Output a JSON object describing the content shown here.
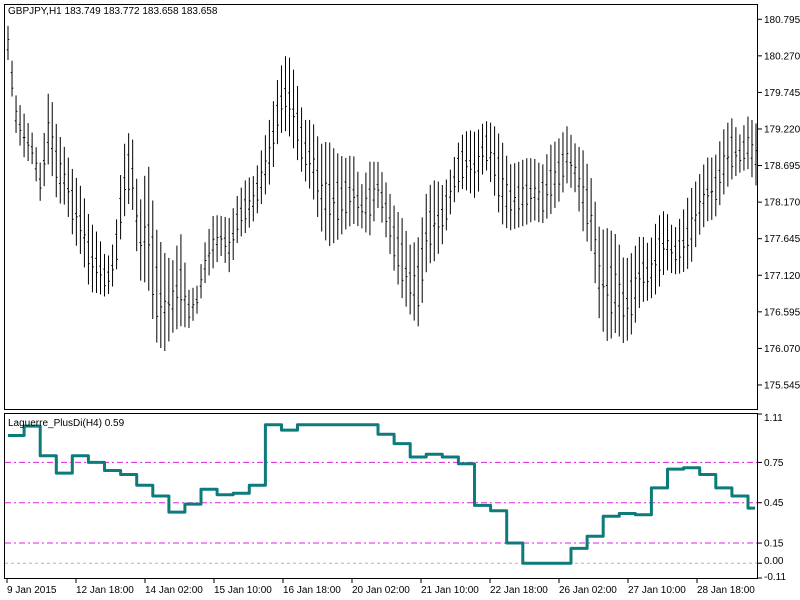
{
  "colors": {
    "background": "#ffffff",
    "frame": "#000000",
    "bars": "#000000",
    "indicator_line": "#0e7b7b",
    "level_line": "#e020e0",
    "zero_level": "#b0b0b0"
  },
  "chart_data": [
    {
      "type": "bar",
      "subtype": "ohlc",
      "title": "GBPJPY,H1  183.749 183.772 183.658 183.658",
      "symbol": "GBPJPY",
      "timeframe": "H1",
      "ohlc_shown": [
        183.749,
        183.772,
        183.658,
        183.658
      ],
      "ylim": [
        175.2,
        181.0
      ],
      "y_ticks": [
        180.795,
        180.27,
        179.745,
        179.22,
        178.695,
        178.17,
        177.645,
        177.12,
        176.595,
        176.07,
        175.545
      ],
      "y_tick_labels": [
        "180.795",
        "180.270",
        "179.745",
        "179.220",
        "178.695",
        "178.170",
        "177.645",
        "177.120",
        "176.595",
        "176.070",
        "175.545"
      ],
      "grid": false,
      "bar_count": 187,
      "bars_high": [
        180.7,
        179.68,
        179.43,
        179.15,
        178.7,
        179.85,
        179.21,
        178.92,
        178.59,
        178.36,
        177.9,
        177.7,
        177.33,
        177.65,
        178.95,
        179.26,
        178.11,
        178.8,
        177.81,
        177.45,
        177.31,
        177.74,
        176.91,
        176.97,
        177.61,
        177.99,
        177.97,
        177.94,
        178.3,
        178.51,
        178.55,
        178.99,
        179.44,
        180.06,
        180.33,
        179.98,
        179.35,
        179.35,
        179.0,
        179.05,
        178.88,
        178.8,
        178.86,
        178.41,
        178.75,
        178.75,
        178.45,
        178.11,
        177.93,
        177.53,
        177.68,
        178.37,
        178.5,
        178.4,
        178.69,
        179.11,
        179.21,
        179.17,
        179.34,
        179.3,
        179.09,
        178.71,
        178.74,
        178.8,
        178.8,
        178.69,
        178.99,
        179.08,
        179.26,
        179.01,
        178.91,
        178.49,
        177.76,
        177.8,
        177.7,
        177.32,
        177.46,
        177.72,
        177.55,
        177.95,
        178.07,
        177.76,
        178.0,
        178.34,
        178.53,
        178.81,
        178.81,
        179.2,
        179.39,
        179.13,
        179.4,
        179.3
      ],
      "bars_low": [
        180.21,
        179.14,
        178.8,
        178.71,
        178.14,
        178.78,
        178.16,
        178.13,
        177.62,
        177.38,
        176.88,
        176.86,
        176.8,
        177.02,
        177.9,
        178.26,
        177.05,
        177.0,
        176.17,
        176.01,
        176.29,
        176.39,
        176.36,
        176.57,
        177.02,
        177.23,
        177.41,
        177.14,
        177.64,
        177.74,
        177.92,
        178.19,
        178.48,
        179.15,
        179.2,
        178.85,
        178.51,
        178.3,
        177.79,
        177.53,
        177.61,
        177.77,
        177.86,
        177.8,
        177.68,
        178.09,
        177.66,
        177.17,
        176.77,
        176.54,
        176.37,
        177.27,
        177.33,
        177.61,
        178.08,
        178.37,
        178.33,
        178.2,
        178.7,
        178.36,
        177.87,
        177.76,
        177.8,
        177.84,
        177.91,
        177.86,
        177.99,
        178.17,
        178.44,
        178.31,
        177.73,
        177.45,
        176.42,
        176.15,
        176.31,
        176.12,
        176.3,
        176.73,
        176.76,
        176.87,
        177.21,
        177.13,
        177.15,
        177.24,
        177.67,
        177.89,
        177.93,
        178.26,
        178.49,
        178.59,
        178.65,
        178.41
      ]
    },
    {
      "type": "line",
      "title": "Laguerre_PlusDi(H4) 0.59",
      "indicator": "Laguerre_PlusDi",
      "timeframe": "H4",
      "current_value": 0.59,
      "ylim": [
        -0.11,
        1.11
      ],
      "y_ticks": [
        1.11,
        0.75,
        0.45,
        0.15,
        0.0,
        -0.11
      ],
      "y_tick_labels": [
        "1.11",
        "0.75",
        "0.45",
        "0.15",
        "0.00",
        "-0.11"
      ],
      "levels": [
        0.75,
        0.45,
        0.15
      ],
      "zero_line": 0.0,
      "grid": false,
      "series": [
        {
          "x_index": [
            0,
            4,
            8,
            12,
            16,
            20,
            24,
            28,
            32,
            36,
            40,
            44,
            48,
            52,
            56,
            60,
            64,
            68,
            72,
            76,
            80,
            84,
            88,
            92,
            96,
            100,
            104,
            108,
            112,
            116,
            120,
            124,
            128,
            132,
            136,
            140,
            144,
            148,
            152,
            156,
            160,
            164,
            168,
            172,
            176,
            180,
            184
          ],
          "values": [
            0.95,
            1.02,
            0.8,
            0.67,
            0.8,
            0.75,
            0.69,
            0.66,
            0.58,
            0.5,
            0.38,
            0.44,
            0.55,
            0.51,
            0.52,
            0.58,
            1.03,
            0.99,
            1.03,
            1.03,
            1.03,
            1.03,
            1.03,
            0.96,
            0.89,
            0.79,
            0.81,
            0.79,
            0.74,
            0.43,
            0.39,
            0.15,
            0.0,
            0.0,
            0.0,
            0.11,
            0.2,
            0.35,
            0.37,
            0.36,
            0.56,
            0.7,
            0.71,
            0.66,
            0.56,
            0.5,
            0.41
          ]
        }
      ]
    }
  ],
  "x_axis": {
    "tick_labels": [
      "9 Jan 2015",
      "12 Jan 18:00",
      "14 Jan 02:00",
      "15 Jan 10:00",
      "16 Jan 18:00",
      "20 Jan 02:00",
      "21 Jan 10:00",
      "22 Jan 18:00",
      "26 Jan 02:00",
      "27 Jan 10:00",
      "28 Jan 18:00"
    ]
  }
}
